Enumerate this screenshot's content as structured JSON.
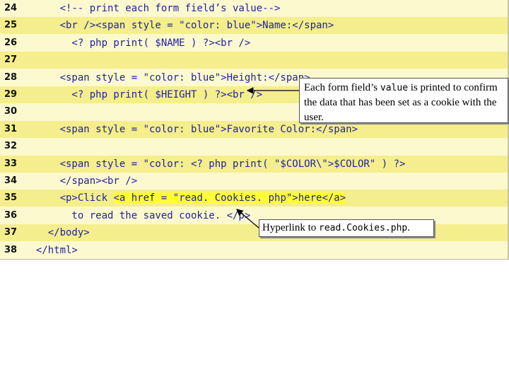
{
  "code_lines": [
    {
      "num": "24",
      "code": "      <!-- print each form field’s value-->"
    },
    {
      "num": "25",
      "code": "      <br /><span style = \"color: blue\">Name:</span>"
    },
    {
      "num": "26",
      "code": "        <? php print( $NAME ) ?><br />"
    },
    {
      "num": "27",
      "code": ""
    },
    {
      "num": "28",
      "code": "      <span style = \"color: blue\">Height:</span>"
    },
    {
      "num": "29",
      "code": "        <? php print( $HEIGHT ) ?><br />"
    },
    {
      "num": "30",
      "code": ""
    },
    {
      "num": "31",
      "code": "      <span style = \"color: blue\">Favorite Color:</span>"
    },
    {
      "num": "32",
      "code": ""
    },
    {
      "num": "33",
      "code": "      <span style = \"color: <? php print( \"$COLOR\\\">$COLOR\" ) ?>"
    },
    {
      "num": "34",
      "code": "      </span><br />"
    },
    {
      "num": "35",
      "code": "      <p>Click ",
      "hl": "<a href = \"read. Cookies. php\">here</a>"
    },
    {
      "num": "36",
      "code": "        to read the saved cookie. </p>"
    },
    {
      "num": "37",
      "code": "    </body>"
    },
    {
      "num": "38",
      "code": "  </html>"
    }
  ],
  "callouts": {
    "value_text1": "Each form field’s ",
    "value_code": "value",
    "value_text2": " is printed to confirm the data that has been set as a cookie with the user.",
    "link_text": "Hyperlink to ",
    "link_code": "read.Cookies.php",
    "link_end": "."
  },
  "colors": {
    "code_bg": "#fdf9cf",
    "alt_row": "#f4ee8c",
    "code_text": "#1f1fa0",
    "highlight": "#ffff33"
  }
}
